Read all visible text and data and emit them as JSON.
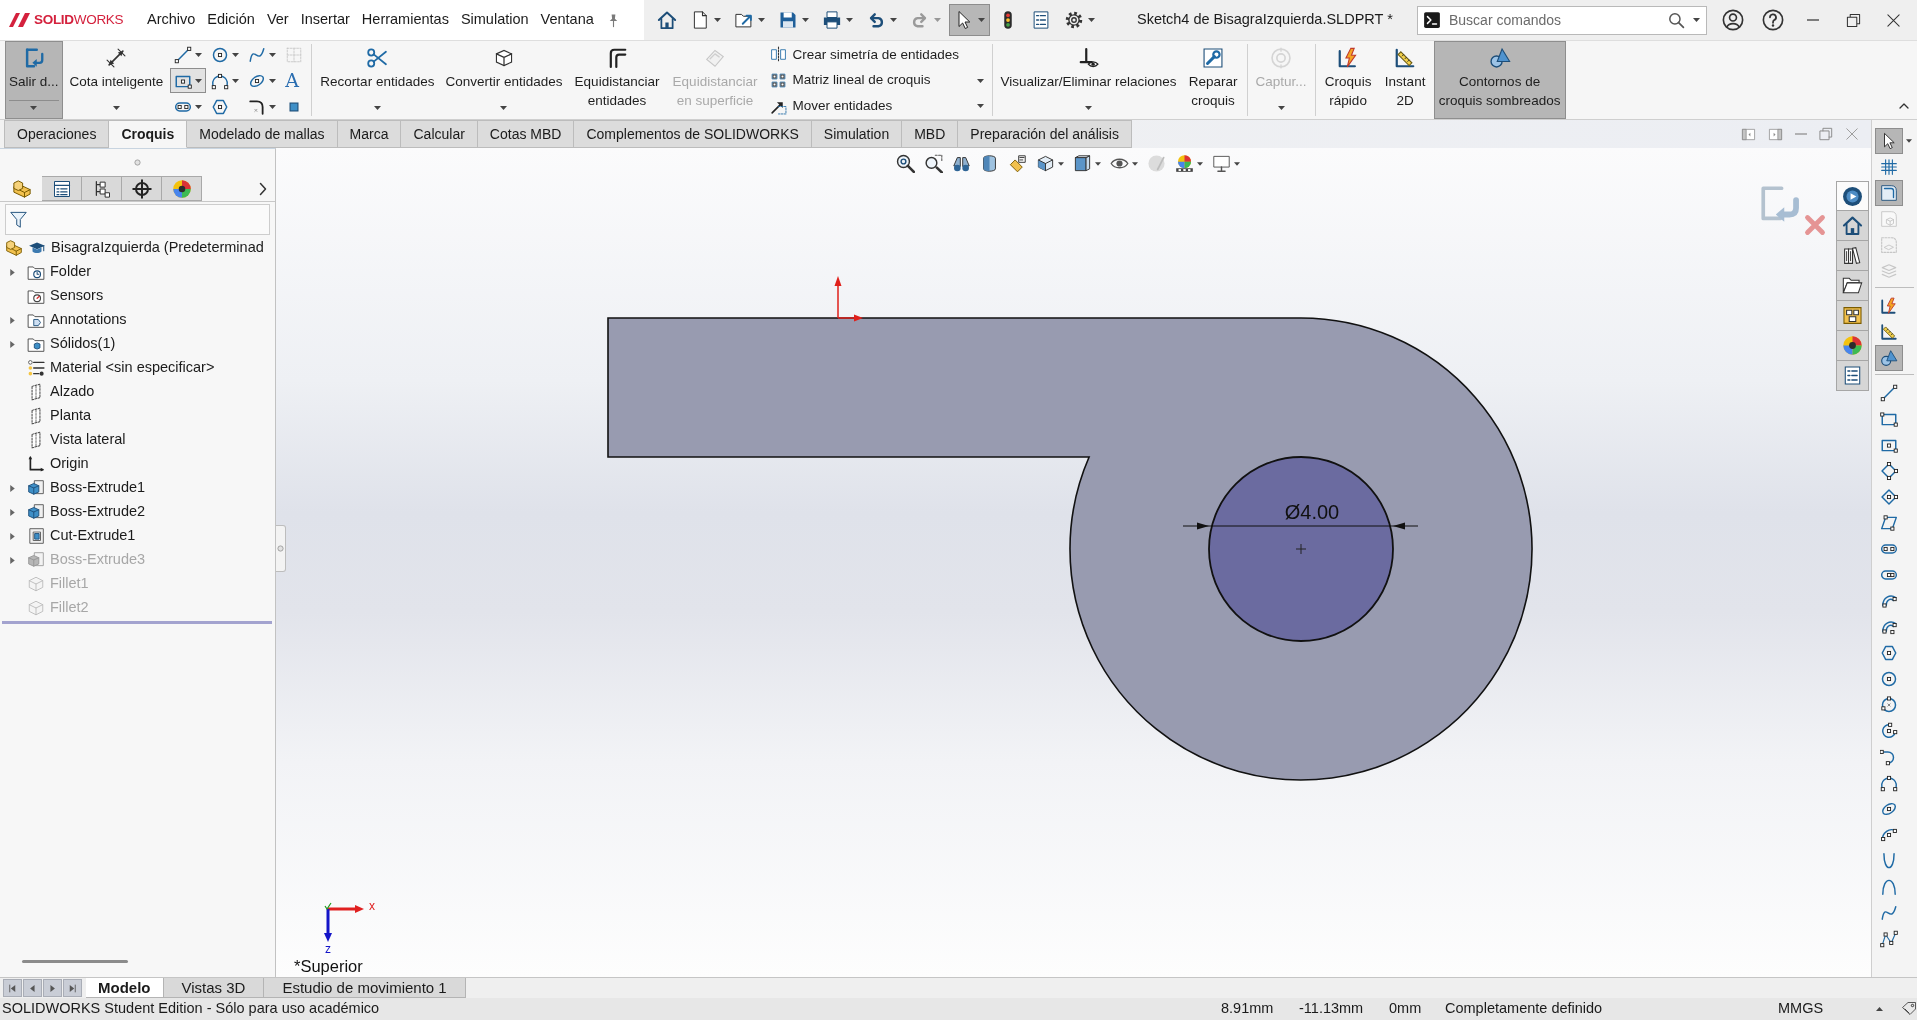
{
  "title_bar": {
    "logo": "**SOLID**WORKS",
    "menu": [
      "Archivo",
      "Edición",
      "Ver",
      "Insertar",
      "Herramientas",
      "Simulation",
      "Ventana"
    ],
    "quick_access": [
      {
        "dropdown": false,
        "pressed": false,
        "disabled": false
      },
      {
        "dropdown": true,
        "pressed": false,
        "disabled": false
      },
      {
        "dropdown": true,
        "pressed": false,
        "disabled": false
      },
      {
        "dropdown": true,
        "pressed": false,
        "disabled": false
      },
      {
        "dropdown": true,
        "pressed": false,
        "disabled": false
      },
      {
        "dropdown": true,
        "pressed": false,
        "disabled": false
      },
      {
        "dropdown": true,
        "pressed": false,
        "disabled": true
      },
      {
        "dropdown": true,
        "pressed": true,
        "disabled": false
      },
      {
        "dropdown": false,
        "pressed": false,
        "disabled": false
      },
      {
        "dropdown": false,
        "pressed": false,
        "disabled": false
      },
      {
        "dropdown": true,
        "pressed": false,
        "disabled": false
      }
    ],
    "document_title": "Sketch4 de BisagraIzquierda.SLDPRT *",
    "search": {
      "placeholder": "Buscar comandos"
    }
  },
  "ribbon": {
    "groups": [
      [
        {
          "kind": "split",
          "label": "Salir d...",
          "pressed": true,
          "disabled": false,
          "dropdown": true
        },
        {
          "kind": "large",
          "label": "Cota inteligente",
          "pressed": false,
          "disabled": false,
          "dropdown": true
        },
        {
          "kind": "tool_grid",
          "tools": [
            {
              "pressed": false,
              "disabled": false,
              "dropdown": true
            },
            {
              "pressed": false,
              "disabled": false,
              "dropdown": true
            },
            {
              "pressed": false,
              "disabled": false,
              "dropdown": true
            },
            {
              "pressed": false,
              "disabled": true,
              "dropdown": false
            },
            {
              "pressed": true,
              "disabled": false,
              "dropdown": true
            },
            {
              "pressed": false,
              "disabled": false,
              "dropdown": true
            },
            {
              "pressed": false,
              "disabled": false,
              "dropdown": true
            },
            {
              "pressed": false,
              "disabled": false,
              "dropdown": false,
              "glyph": "A"
            },
            {
              "pressed": false,
              "disabled": false,
              "dropdown": true
            },
            {
              "pressed": false,
              "disabled": false,
              "dropdown": false
            },
            {
              "pressed": false,
              "disabled": false,
              "dropdown": true
            },
            {
              "pressed": false,
              "disabled": false,
              "dropdown": false
            }
          ]
        }
      ],
      [
        {
          "kind": "large",
          "label": "Recortar entidades",
          "pressed": false,
          "disabled": false,
          "dropdown": true
        },
        {
          "kind": "large",
          "label": "Convertir entidades",
          "pressed": false,
          "disabled": false,
          "dropdown": true
        },
        {
          "kind": "stacked",
          "label": "Equidistanciar entidades",
          "pressed": false,
          "disabled": false,
          "dropdown": false
        },
        {
          "kind": "stacked",
          "label": "Equidistanciar en superficie",
          "pressed": false,
          "disabled": true,
          "dropdown": false
        },
        {
          "kind": "row_list",
          "rows": [
            {
              "label": "Crear simetría de entidades",
              "dropdown": false
            },
            {
              "label": "Matriz lineal de croquis",
              "dropdown": true
            },
            {
              "label": "Mover entidades",
              "dropdown": true
            }
          ]
        }
      ],
      [
        {
          "kind": "large",
          "label": "Visualizar/Eliminar relaciones",
          "pressed": false,
          "disabled": false,
          "dropdown": true
        },
        {
          "kind": "stacked",
          "label": "Reparar croquis",
          "pressed": false,
          "disabled": false,
          "dropdown": false
        }
      ],
      [
        {
          "kind": "large",
          "label": "Captur...",
          "pressed": false,
          "disabled": true,
          "dropdown": true
        }
      ],
      [
        {
          "kind": "stacked",
          "label": "Croquis rápido",
          "pressed": false,
          "disabled": false,
          "dropdown": false
        },
        {
          "kind": "stacked",
          "label": "Instant 2D",
          "pressed": false,
          "disabled": false,
          "dropdown": false
        },
        {
          "kind": "stacked",
          "label": "Contornos de croquis sombreados",
          "pressed": true,
          "disabled": false,
          "dropdown": false
        }
      ]
    ]
  },
  "tabs": [
    {
      "label": "Operaciones",
      "selected": false
    },
    {
      "label": "Croquis",
      "selected": true
    },
    {
      "label": "Modelado de mallas",
      "selected": false
    },
    {
      "label": "Marca",
      "selected": false
    },
    {
      "label": "Calcular",
      "selected": false
    },
    {
      "label": "Cotas MBD",
      "selected": false
    },
    {
      "label": "Complementos de SOLIDWORKS",
      "selected": false
    },
    {
      "label": "Simulation",
      "selected": false
    },
    {
      "label": "MBD",
      "selected": false
    },
    {
      "label": "Preparación del análisis",
      "selected": false
    }
  ],
  "feature_tree": {
    "panel_tabs": [
      {
        "selected": true
      },
      {
        "selected": false
      },
      {
        "selected": false
      },
      {
        "selected": false
      },
      {
        "selected": false
      }
    ],
    "root": {
      "label": "BisagraIzquierda (Predeterminad"
    },
    "items": [
      {
        "kind": "history_folder",
        "label": "Folder",
        "expanded": false,
        "suppressed": false
      },
      {
        "kind": "sensor_folder",
        "label": "Sensors",
        "suppressed": false
      },
      {
        "kind": "annotation_folder",
        "label": "Annotations",
        "expanded": false,
        "suppressed": false
      },
      {
        "kind": "body_folder",
        "label": "Sólidos(1)",
        "expanded": false,
        "suppressed": false
      },
      {
        "kind": "material",
        "label": "Material <sin especificar>",
        "suppressed": false
      },
      {
        "kind": "plane",
        "label": "Alzado",
        "suppressed": false
      },
      {
        "kind": "plane",
        "label": "Planta",
        "suppressed": false
      },
      {
        "kind": "plane",
        "label": "Vista lateral",
        "suppressed": false
      },
      {
        "kind": "origin",
        "label": "Origin",
        "suppressed": false
      },
      {
        "kind": "boss",
        "label": "Boss-Extrude1",
        "expanded": false,
        "suppressed": false
      },
      {
        "kind": "boss",
        "label": "Boss-Extrude2",
        "expanded": false,
        "suppressed": false
      },
      {
        "kind": "cut",
        "label": "Cut-Extrude1",
        "expanded": false,
        "suppressed": false
      },
      {
        "kind": "boss",
        "label": "Boss-Extrude3",
        "expanded": false,
        "suppressed": true
      },
      {
        "kind": "fillet",
        "label": "Fillet1",
        "suppressed": true
      },
      {
        "kind": "fillet",
        "label": "Fillet2",
        "suppressed": true
      }
    ]
  },
  "graphics": {
    "dimension": "Ø4.00",
    "triad": {
      "x_label": "x",
      "z_label": "z"
    },
    "view_name": "*Superior"
  },
  "task_pane": [
    {
      "selected": true
    },
    {
      "selected": false
    },
    {
      "selected": false
    },
    {
      "selected": false
    },
    {
      "selected": false
    },
    {
      "selected": false
    },
    {
      "selected": false
    }
  ],
  "sketch_strip": {
    "groups": [
      [
        {
          "pressed": true,
          "disabled": false,
          "dropdown": true
        },
        {
          "pressed": false,
          "disabled": false
        },
        {
          "pressed": true,
          "disabled": false
        },
        {
          "pressed": false,
          "disabled": true
        },
        {
          "pressed": false,
          "disabled": true
        },
        {
          "pressed": false,
          "disabled": true
        }
      ],
      [
        {
          "pressed": false,
          "disabled": false
        },
        {
          "pressed": false,
          "disabled": false
        },
        {
          "pressed": true,
          "disabled": false
        }
      ],
      [
        {
          "pressed": false,
          "disabled": false
        },
        {
          "pressed": false,
          "disabled": false
        },
        {
          "pressed": false,
          "disabled": false
        },
        {
          "pressed": false,
          "disabled": false
        },
        {
          "pressed": false,
          "disabled": false
        },
        {
          "pressed": false,
          "disabled": false
        },
        {
          "pressed": false,
          "disabled": false
        },
        {
          "pressed": false,
          "disabled": false
        },
        {
          "pressed": false,
          "disabled": false
        },
        {
          "pressed": false,
          "disabled": false
        },
        {
          "pressed": false,
          "disabled": false
        },
        {
          "pressed": false,
          "disabled": false
        },
        {
          "pressed": false,
          "disabled": false
        },
        {
          "pressed": false,
          "disabled": false
        },
        {
          "pressed": false,
          "disabled": false
        },
        {
          "pressed": false,
          "disabled": false
        },
        {
          "pressed": false,
          "disabled": false
        },
        {
          "pressed": false,
          "disabled": false
        },
        {
          "pressed": false,
          "disabled": false
        },
        {
          "pressed": false,
          "disabled": false
        },
        {
          "pressed": false,
          "disabled": false
        },
        {
          "pressed": false,
          "disabled": false
        }
      ]
    ]
  },
  "bottom_tabs": [
    {
      "label": "Modelo",
      "selected": true
    },
    {
      "label": "Vistas 3D",
      "selected": false
    },
    {
      "label": "Estudio de movimiento 1",
      "selected": false
    }
  ],
  "status_bar": {
    "message": "SOLIDWORKS Student Edition - Sólo para uso académico",
    "coordinates": [
      "8.91mm",
      "-11.13mm",
      "0mm"
    ],
    "sketch_state": "Completamente definido",
    "units": "MMGS"
  }
}
